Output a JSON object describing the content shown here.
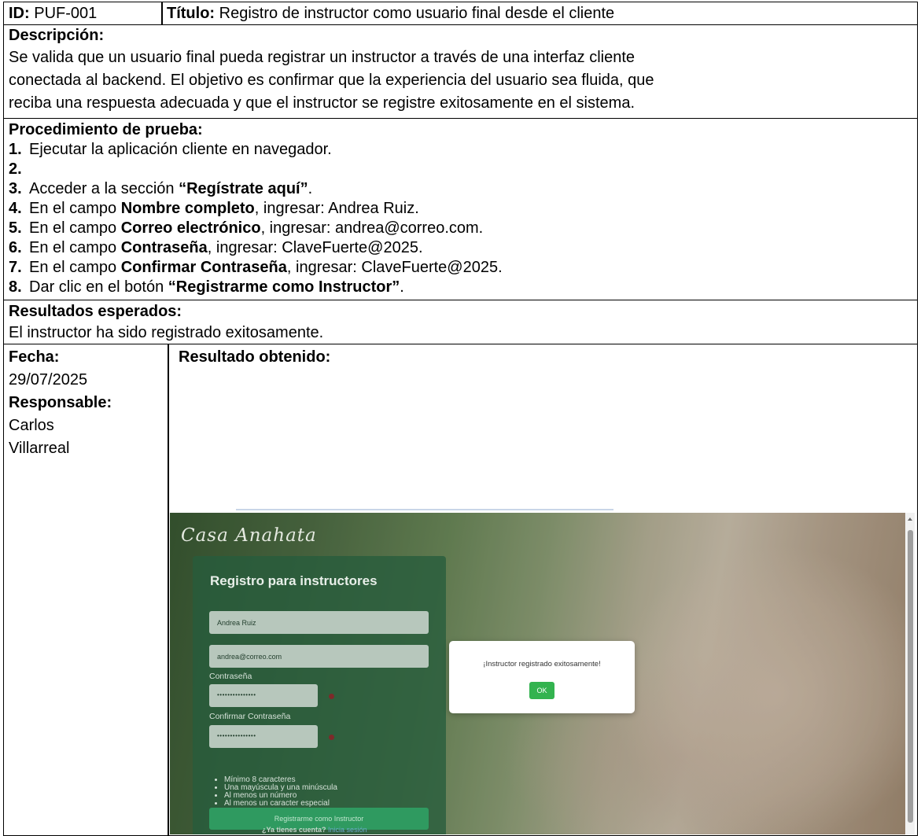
{
  "header": {
    "id_label": "ID:",
    "id_value": "PUF-001",
    "title_label": "Título:",
    "title_value": "Registro de instructor como usuario final desde el cliente"
  },
  "description": {
    "label": "Descripción:",
    "lines": [
      "Se valida que un usuario final pueda registrar un instructor a través de una interfaz cliente",
      "conectada al backend. El objetivo es confirmar que la experiencia del usuario sea fluida, que",
      "reciba una respuesta adecuada y que el instructor se registre exitosamente en el sistema."
    ]
  },
  "procedure": {
    "label": "Procedimiento de prueba:",
    "steps": [
      {
        "n": "1.",
        "pre": "Ejecutar la aplicación cliente en navegador.",
        "bold": "",
        "post": ""
      },
      {
        "n": "2.",
        "pre": "",
        "bold": "",
        "post": ""
      },
      {
        "n": "3.",
        "pre": "Acceder a la sección ",
        "bold": "“Regístrate aquí”",
        "post": "."
      },
      {
        "n": "4.",
        "pre": "En el campo ",
        "bold": "Nombre completo",
        "post": ", ingresar: Andrea Ruiz."
      },
      {
        "n": "5.",
        "pre": "En el campo ",
        "bold": "Correo electrónico",
        "post": ", ingresar: andrea@correo.com."
      },
      {
        "n": "6.",
        "pre": "En el campo ",
        "bold": "Contraseña",
        "post": ", ingresar: ClaveFuerte@2025."
      },
      {
        "n": "7.",
        "pre": "En el campo ",
        "bold": "Confirmar Contraseña",
        "post": ", ingresar: ClaveFuerte@2025."
      },
      {
        "n": "8.",
        "pre": "Dar clic en el botón ",
        "bold": "“Registrarme como Instructor”",
        "post": "."
      }
    ]
  },
  "expected": {
    "label": "Resultados esperados:",
    "text": "El instructor ha sido registrado exitosamente."
  },
  "meta": {
    "date_label": "Fecha:",
    "date_value": "29/07/2025",
    "responsible_label": "Responsable:",
    "responsible_line1": "Carlos",
    "responsible_line2": "Villarreal",
    "result_label": "Resultado obtenido:"
  },
  "screenshot": {
    "brand": "Casa Anahata",
    "form_title": "Registro para instructores",
    "name_value": "Andrea Ruiz",
    "email_value": "andrea@correo.com",
    "password_label": "Contraseña",
    "password_mask": "•••••••••••••••",
    "confirm_label": "Confirmar Contraseña",
    "confirm_mask": "•••••••••••••••",
    "requirements": [
      "Mínimo 8 caracteres",
      "Una mayúscula y una minúscula",
      "Al menos un número",
      "Al menos un caracter especial"
    ],
    "submit_label": "Registrarme como Instructor",
    "login_prompt": "¿Ya tienes cuenta?",
    "login_link": "Inicia sesión",
    "modal_message": "¡Instructor registrado exitosamente!",
    "modal_ok": "OK"
  }
}
